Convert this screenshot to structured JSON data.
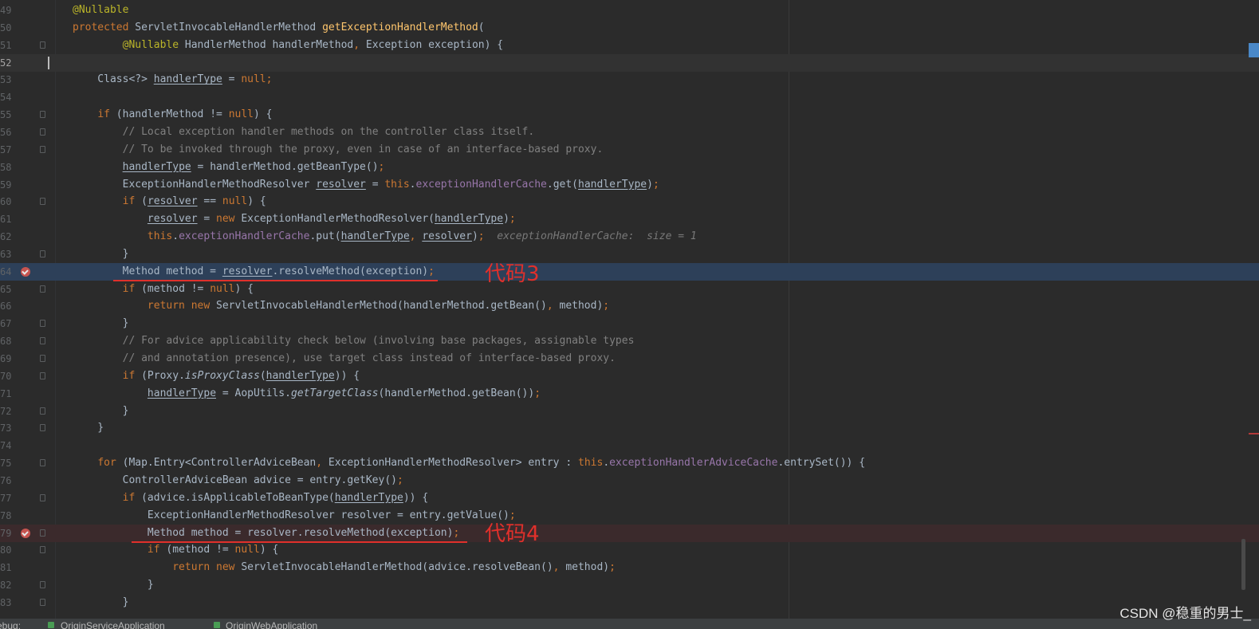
{
  "editor": {
    "lines": [
      {
        "n": "49",
        "segs": [
          {
            "t": "@Nullable",
            "c": "ann"
          }
        ]
      },
      {
        "n": "50",
        "segs": [
          {
            "t": "protected ",
            "c": "kw"
          },
          {
            "t": "ServletInvocableHandlerMethod "
          },
          {
            "t": "getExceptionHandlerMethod",
            "c": "fn"
          },
          {
            "t": "("
          }
        ]
      },
      {
        "n": "51",
        "segs": [
          {
            "t": "        "
          },
          {
            "t": "@Nullable",
            "c": "ann"
          },
          {
            "t": " HandlerMethod handlerMethod"
          },
          {
            "t": ", ",
            "c": "kw"
          },
          {
            "t": "Exception exception) {"
          }
        ]
      },
      {
        "n": "52",
        "current": true,
        "segs": []
      },
      {
        "n": "53",
        "segs": [
          {
            "t": "    Class<?> "
          },
          {
            "t": "handlerType",
            "c": "ul"
          },
          {
            "t": " = "
          },
          {
            "t": "null;",
            "c": "kw"
          }
        ]
      },
      {
        "n": "54",
        "segs": []
      },
      {
        "n": "55",
        "segs": [
          {
            "t": "    "
          },
          {
            "t": "if ",
            "c": "kw"
          },
          {
            "t": "(handlerMethod != "
          },
          {
            "t": "null",
            "c": "kw"
          },
          {
            "t": ") {"
          }
        ]
      },
      {
        "n": "56",
        "segs": [
          {
            "t": "        "
          },
          {
            "t": "// Local exception handler methods on the controller class itself.",
            "c": "cmt"
          }
        ]
      },
      {
        "n": "57",
        "segs": [
          {
            "t": "        "
          },
          {
            "t": "// To be invoked through the proxy, even in case of an interface-based proxy.",
            "c": "cmt"
          }
        ]
      },
      {
        "n": "58",
        "segs": [
          {
            "t": "        "
          },
          {
            "t": "handlerType",
            "c": "ul"
          },
          {
            "t": " = handlerMethod.getBeanType()"
          },
          {
            "t": ";",
            "c": "kw"
          }
        ]
      },
      {
        "n": "59",
        "segs": [
          {
            "t": "        ExceptionHandlerMethodResolver "
          },
          {
            "t": "resolver",
            "c": "ul"
          },
          {
            "t": " = "
          },
          {
            "t": "this",
            "c": "kw"
          },
          {
            "t": "."
          },
          {
            "t": "exceptionHandlerCache",
            "c": "fld"
          },
          {
            "t": ".get("
          },
          {
            "t": "handlerType",
            "c": "ul"
          },
          {
            "t": ")"
          },
          {
            "t": ";",
            "c": "kw"
          }
        ]
      },
      {
        "n": "60",
        "segs": [
          {
            "t": "        "
          },
          {
            "t": "if ",
            "c": "kw"
          },
          {
            "t": "("
          },
          {
            "t": "resolver",
            "c": "ul"
          },
          {
            "t": " == "
          },
          {
            "t": "null",
            "c": "kw"
          },
          {
            "t": ") {"
          }
        ]
      },
      {
        "n": "61",
        "segs": [
          {
            "t": "            "
          },
          {
            "t": "resolver",
            "c": "ul"
          },
          {
            "t": " = "
          },
          {
            "t": "new ",
            "c": "kw"
          },
          {
            "t": "ExceptionHandlerMethodResolver("
          },
          {
            "t": "handlerType",
            "c": "ul"
          },
          {
            "t": ")"
          },
          {
            "t": ";",
            "c": "kw"
          }
        ]
      },
      {
        "n": "62",
        "segs": [
          {
            "t": "            "
          },
          {
            "t": "this",
            "c": "kw"
          },
          {
            "t": "."
          },
          {
            "t": "exceptionHandlerCache",
            "c": "fld"
          },
          {
            "t": ".put("
          },
          {
            "t": "handlerType",
            "c": "ul"
          },
          {
            "t": ", ",
            "c": "kw"
          },
          {
            "t": "resolver",
            "c": "ul"
          },
          {
            "t": ")"
          },
          {
            "t": ";",
            "c": "kw"
          },
          {
            "t": "  exceptionHandlerCache:  size = 1",
            "c": "hint"
          }
        ]
      },
      {
        "n": "63",
        "segs": [
          {
            "t": "        }"
          }
        ]
      },
      {
        "n": "64",
        "exec": true,
        "bp": true,
        "segs": [
          {
            "t": "        Method method = "
          },
          {
            "t": "resolver",
            "c": "ul"
          },
          {
            "t": ".resolveMethod(exception)"
          },
          {
            "t": ";",
            "c": "kw"
          }
        ]
      },
      {
        "n": "65",
        "segs": [
          {
            "t": "        "
          },
          {
            "t": "if ",
            "c": "kw"
          },
          {
            "t": "(method != "
          },
          {
            "t": "null",
            "c": "kw"
          },
          {
            "t": ") {"
          }
        ]
      },
      {
        "n": "66",
        "segs": [
          {
            "t": "            "
          },
          {
            "t": "return new ",
            "c": "kw"
          },
          {
            "t": "ServletInvocableHandlerMethod(handlerMethod.getBean()"
          },
          {
            "t": ", ",
            "c": "kw"
          },
          {
            "t": "method)"
          },
          {
            "t": ";",
            "c": "kw"
          }
        ]
      },
      {
        "n": "67",
        "segs": [
          {
            "t": "        }"
          }
        ]
      },
      {
        "n": "68",
        "segs": [
          {
            "t": "        "
          },
          {
            "t": "// For advice applicability check below (involving base packages, assignable types",
            "c": "cmt"
          }
        ]
      },
      {
        "n": "69",
        "segs": [
          {
            "t": "        "
          },
          {
            "t": "// and annotation presence), use target class instead of interface-based proxy.",
            "c": "cmt"
          }
        ]
      },
      {
        "n": "70",
        "segs": [
          {
            "t": "        "
          },
          {
            "t": "if ",
            "c": "kw"
          },
          {
            "t": "(Proxy."
          },
          {
            "t": "isProxyClass",
            "c": "it"
          },
          {
            "t": "("
          },
          {
            "t": "handlerType",
            "c": "ul"
          },
          {
            "t": ")) {"
          }
        ]
      },
      {
        "n": "71",
        "segs": [
          {
            "t": "            "
          },
          {
            "t": "handlerType",
            "c": "ul"
          },
          {
            "t": " = AopUtils."
          },
          {
            "t": "getTargetClass",
            "c": "it"
          },
          {
            "t": "(handlerMethod.getBean())"
          },
          {
            "t": ";",
            "c": "kw"
          }
        ]
      },
      {
        "n": "72",
        "segs": [
          {
            "t": "        }"
          }
        ]
      },
      {
        "n": "73",
        "segs": [
          {
            "t": "    }"
          }
        ]
      },
      {
        "n": "74",
        "segs": []
      },
      {
        "n": "75",
        "segs": [
          {
            "t": "    "
          },
          {
            "t": "for ",
            "c": "kw"
          },
          {
            "t": "(Map.Entry<ControllerAdviceBean"
          },
          {
            "t": ", ",
            "c": "kw"
          },
          {
            "t": "ExceptionHandlerMethodResolver> entry : "
          },
          {
            "t": "this",
            "c": "kw"
          },
          {
            "t": "."
          },
          {
            "t": "exceptionHandlerAdviceCache",
            "c": "fld"
          },
          {
            "t": ".entrySet()) {"
          }
        ]
      },
      {
        "n": "76",
        "segs": [
          {
            "t": "        ControllerAdviceBean advice = entry.getKey()"
          },
          {
            "t": ";",
            "c": "kw"
          }
        ]
      },
      {
        "n": "77",
        "segs": [
          {
            "t": "        "
          },
          {
            "t": "if ",
            "c": "kw"
          },
          {
            "t": "(advice.isApplicableToBeanType("
          },
          {
            "t": "handlerType",
            "c": "ul"
          },
          {
            "t": ")) {"
          }
        ]
      },
      {
        "n": "78",
        "segs": [
          {
            "t": "            ExceptionHandlerMethodResolver resolver = entry.getValue()"
          },
          {
            "t": ";",
            "c": "kw"
          }
        ]
      },
      {
        "n": "79",
        "bp": true,
        "bpline": true,
        "segs": [
          {
            "t": "            Method method = resolver.resolveMethod(exception)"
          },
          {
            "t": ";",
            "c": "kw"
          }
        ]
      },
      {
        "n": "80",
        "segs": [
          {
            "t": "            "
          },
          {
            "t": "if ",
            "c": "kw"
          },
          {
            "t": "(method != "
          },
          {
            "t": "null",
            "c": "kw"
          },
          {
            "t": ") {"
          }
        ]
      },
      {
        "n": "81",
        "segs": [
          {
            "t": "                "
          },
          {
            "t": "return new ",
            "c": "kw"
          },
          {
            "t": "ServletInvocableHandlerMethod(advice.resolveBean()"
          },
          {
            "t": ", ",
            "c": "kw"
          },
          {
            "t": "method)"
          },
          {
            "t": ";",
            "c": "kw"
          }
        ]
      },
      {
        "n": "82",
        "segs": [
          {
            "t": "            }"
          }
        ]
      },
      {
        "n": "83",
        "segs": [
          {
            "t": "        }"
          }
        ]
      }
    ]
  },
  "annotations": {
    "label_code3": "代码3",
    "label_code4": "代码4"
  },
  "debug_bar": {
    "label": "ebug:",
    "tab1": "OriginServiceApplication",
    "tab2": "OriginWebApplication"
  },
  "watermark": "CSDN @稳重的男士_",
  "colors": {
    "background": "#2b2b2b",
    "keyword": "#cc7832",
    "annotation": "#bbb529",
    "method_decl": "#ffc66d",
    "field": "#9876aa",
    "comment": "#808080",
    "execution_line": "#2d4059",
    "breakpoint_line": "#3b2a2c",
    "breakpoint": "#c75450",
    "markup_red": "#e0302b"
  }
}
